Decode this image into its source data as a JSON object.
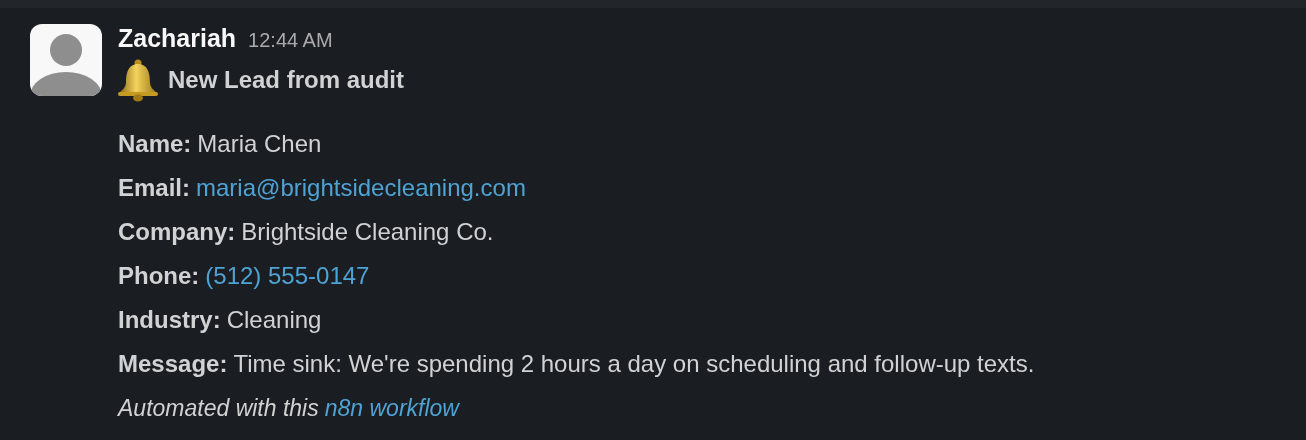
{
  "message": {
    "sender": "Zachariah",
    "time": "12:44 AM",
    "title": "New Lead from audit",
    "fields": [
      {
        "label": "Name:",
        "value": "Maria Chen",
        "kind": "text"
      },
      {
        "label": "Email:",
        "value": "maria@brightsidecleaning.com",
        "kind": "link"
      },
      {
        "label": "Company:",
        "value": "Brightside Cleaning Co.",
        "kind": "text"
      },
      {
        "label": "Phone:",
        "value": "(512) 555-0147",
        "kind": "link"
      },
      {
        "label": "Industry:",
        "value": "Cleaning",
        "kind": "text"
      },
      {
        "label": "Message:",
        "value": "Time sink: We're spending 2 hours a day on scheduling and follow-up texts.",
        "kind": "text"
      }
    ],
    "footer": {
      "text": "Automated with this",
      "link": "n8n workflow"
    }
  }
}
